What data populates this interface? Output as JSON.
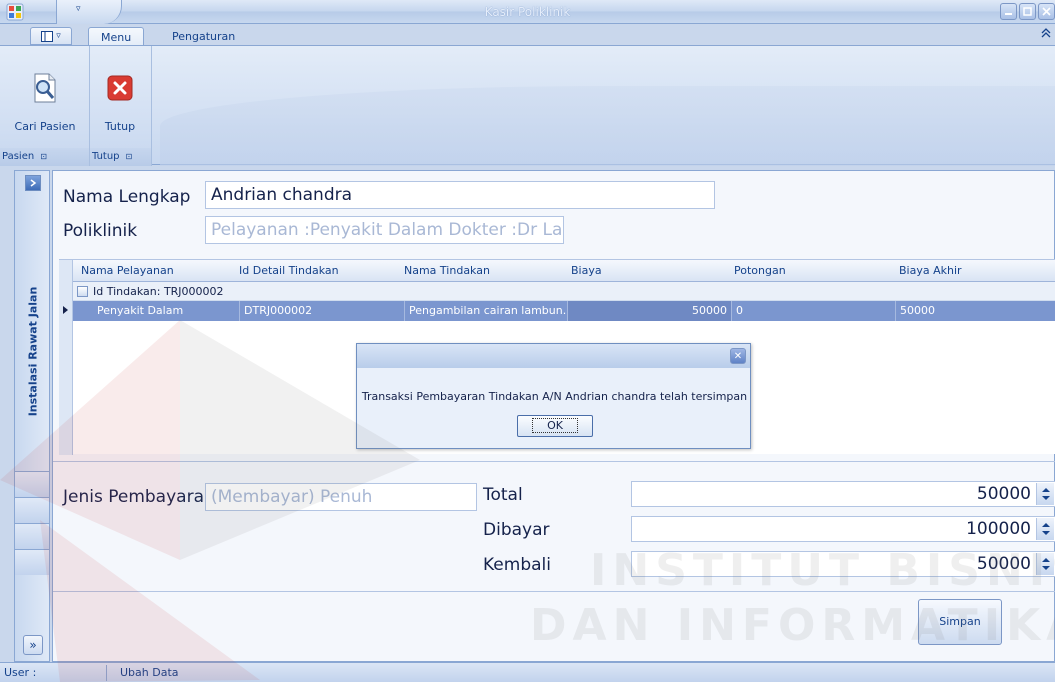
{
  "window": {
    "title": "Kasir Poliklinik",
    "qat_dropdown": "▿"
  },
  "ribbon": {
    "app_menu_glyph": "▿",
    "tabs": [
      {
        "label": "Menu",
        "active": true
      },
      {
        "label": "Pengaturan",
        "active": false
      }
    ],
    "collapse_glyph": "»",
    "groups": [
      {
        "label": "Pasien",
        "button": "Cari Pasien",
        "launcher": "⊡"
      },
      {
        "label": "Tutup",
        "button": "Tutup",
        "launcher": "⊡"
      }
    ]
  },
  "nav": {
    "vertical_title": "Instalasi Rawat Jalan",
    "expand_glyph": "»"
  },
  "form": {
    "nama_label": "Nama Lengkap",
    "nama_value": "Andrian chandra",
    "poli_label": "Poliklinik",
    "poli_value": "Pelayanan :Penyakit Dalam Dokter :Dr Lala"
  },
  "grid": {
    "columns": [
      "Nama Pelayanan",
      "Id Detail Tindakan",
      "Nama Tindakan",
      "Biaya",
      "Potongan",
      "Biaya Akhir"
    ],
    "group_label": "Id Tindakan: TRJ000002",
    "row": {
      "nama_pelayanan": "Penyakit Dalam",
      "id_detail": "DTRJ000002",
      "nama_tindakan": "Pengambilan cairan lambun...",
      "biaya": "50000",
      "potongan": "0",
      "biaya_akhir": "50000"
    }
  },
  "dialog": {
    "message": "Transaksi Pembayaran Tindakan A/N Andrian chandra telah tersimpan",
    "ok_label": "OK",
    "close_glyph": "✕"
  },
  "payment": {
    "jenis_label": "Jenis Pembayaran",
    "jenis_value": "(Membayar) Penuh",
    "total_label": "Total",
    "total_value": "50000",
    "dibayar_label": "Dibayar",
    "dibayar_value": "100000",
    "kembali_label": "Kembali",
    "kembali_value": "50000",
    "simpan_label": "Simpan"
  },
  "status": {
    "user_label": "User :",
    "mode": "Ubah Data"
  },
  "watermark": {
    "line1": "INSTITUT BISNIS",
    "line2": "DAN INFORMATIKA"
  }
}
